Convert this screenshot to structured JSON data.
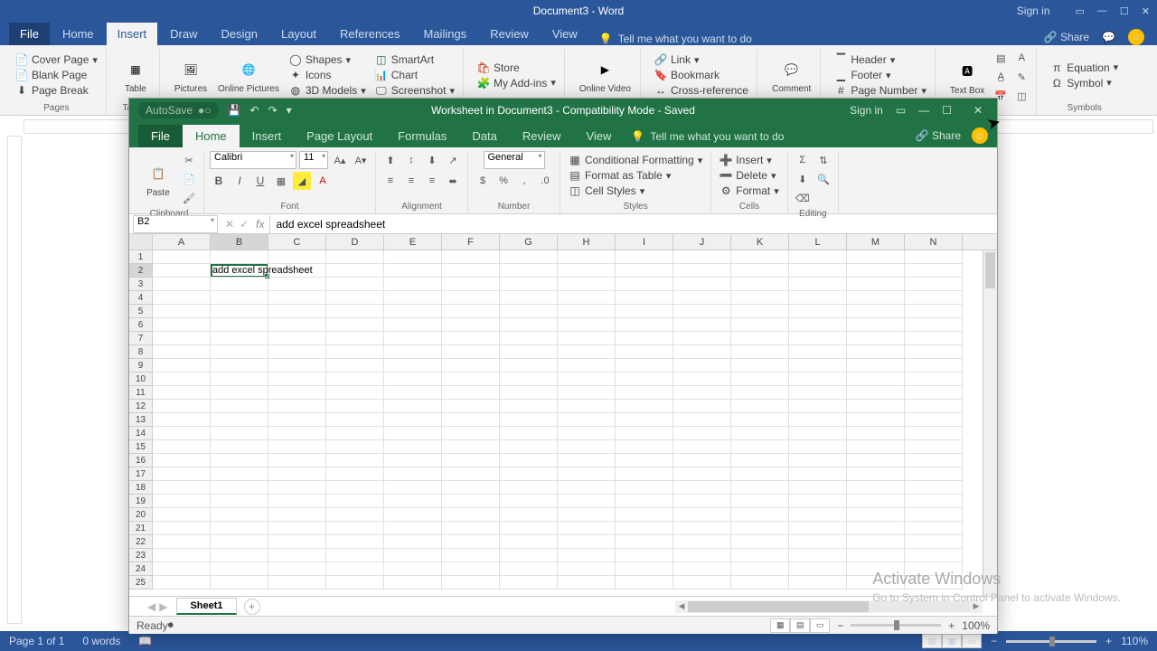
{
  "word": {
    "title": "Document3  -  Word",
    "signin": "Sign in",
    "tabs": {
      "file": "File",
      "home": "Home",
      "insert": "Insert",
      "draw": "Draw",
      "design": "Design",
      "layout": "Layout",
      "references": "References",
      "mailings": "Mailings",
      "review": "Review",
      "view": "View"
    },
    "tellme": "Tell me what you want to do",
    "share": "Share",
    "ribbon": {
      "pages": {
        "cover": "Cover Page",
        "blank": "Blank Page",
        "break": "Page Break",
        "label": "Pages"
      },
      "tables": {
        "table": "Table",
        "label": "Tables"
      },
      "illus": {
        "pictures": "Pictures",
        "online": "Online Pictures",
        "shapes": "Shapes",
        "icons": "Icons",
        "models": "3D Models",
        "smartart": "SmartArt",
        "chart": "Chart",
        "screenshot": "Screenshot"
      },
      "addins": {
        "store": "Store",
        "myaddins": "My Add-ins"
      },
      "media": {
        "video": "Online Video"
      },
      "links": {
        "link": "Link",
        "bookmark": "Bookmark",
        "crossref": "Cross-reference"
      },
      "comments": {
        "comment": "Comment"
      },
      "hf": {
        "header": "Header",
        "footer": "Footer",
        "pagenum": "Page Number"
      },
      "text": {
        "textbox": "Text Box"
      },
      "symbols": {
        "equation": "Equation",
        "symbol": "Symbol"
      }
    },
    "status": {
      "page": "Page 1 of 1",
      "words": "0 words",
      "zoom": "110%"
    }
  },
  "excel": {
    "autosave": "AutoSave",
    "title": "Worksheet in Document3  -  Compatibility Mode  -  Saved",
    "signin": "Sign in",
    "tabs": {
      "file": "File",
      "home": "Home",
      "insert": "Insert",
      "pagelayout": "Page Layout",
      "formulas": "Formulas",
      "data": "Data",
      "review": "Review",
      "view": "View"
    },
    "tellme": "Tell me what you want to do",
    "share": "Share",
    "ribbon": {
      "clipboard": "Clipboard",
      "paste": "Paste",
      "font": "Font",
      "fontname": "Calibri",
      "fontsize": "11",
      "alignment": "Alignment",
      "number": "Number",
      "numfmt": "General",
      "styles": "Styles",
      "condfmt": "Conditional Formatting",
      "table": "Format as Table",
      "cellstyles": "Cell Styles",
      "cells": "Cells",
      "insert": "Insert",
      "delete": "Delete",
      "format": "Format",
      "editing": "Editing"
    },
    "namebox": "B2",
    "formula": "add excel spreadsheet",
    "columns": [
      "A",
      "B",
      "C",
      "D",
      "E",
      "F",
      "G",
      "H",
      "I",
      "J",
      "K",
      "L",
      "M",
      "N"
    ],
    "cellB2": "add excel spreadsheet",
    "sheet": "Sheet1",
    "status": {
      "ready": "Ready",
      "zoom": "100%"
    }
  },
  "watermark": {
    "title": "Activate Windows",
    "sub": "Go to System in Control Panel to activate Windows."
  }
}
